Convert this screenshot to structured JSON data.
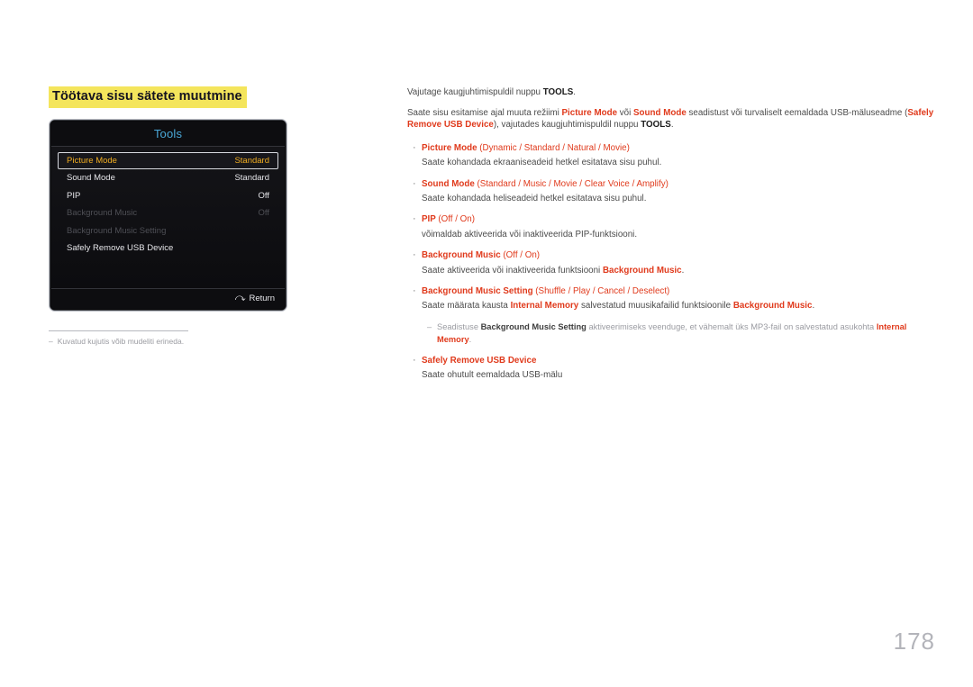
{
  "page": {
    "number": "178",
    "accent_red": "#e03a1c",
    "highlight_yellow": "#f4e55c",
    "osd_selected_orange": "#f0ad22",
    "osd_title_blue": "#4aa8d8"
  },
  "left": {
    "section_title": "Töötava sisu sätete muutmine",
    "osd": {
      "title": "Tools",
      "rows": [
        {
          "label": "Picture Mode",
          "value": "Standard",
          "state": "selected"
        },
        {
          "label": "Sound Mode",
          "value": "Standard",
          "state": "normal"
        },
        {
          "label": "PIP",
          "value": "Off",
          "state": "normal"
        },
        {
          "label": "Background Music",
          "value": "Off",
          "state": "disabled"
        },
        {
          "label": "Background Music Setting",
          "value": "",
          "state": "disabled"
        },
        {
          "label": "Safely Remove USB Device",
          "value": "",
          "state": "normal"
        }
      ],
      "footer": {
        "return_label": "Return",
        "return_icon": "return-arrow-icon"
      }
    },
    "note": {
      "dash": "–",
      "text": "Kuvatud kujutis võib mudeliti erineda."
    }
  },
  "right": {
    "paragraph1": {
      "before": "Vajutage kaugjuhtimispuldil nuppu ",
      "bold": "TOOLS",
      "after": "."
    },
    "paragraph2": {
      "seg1": "Saate sisu esitamise ajal muuta režiimi ",
      "red1": "Picture Mode",
      "seg2": " või ",
      "red2": "Sound Mode",
      "seg3": " seadistust või turvaliselt eemaldada USB-mäluseadme (",
      "red3": "Safely Remove USB Device",
      "seg4": "), vajutades kaugjuhtimispuldil nuppu ",
      "bold1": "TOOLS",
      "seg5": "."
    },
    "bullet_marker": "·",
    "bullets": [
      {
        "name": "Picture Mode",
        "options": "(Dynamic / Standard / Natural / Movie)",
        "desc": "Saate kohandada ekraaniseadeid hetkel esitatava sisu puhul."
      },
      {
        "name": "Sound Mode",
        "options": "(Standard / Music / Movie / Clear Voice / Amplify)",
        "desc": "Saate kohandada heliseadeid hetkel esitatava sisu puhul."
      },
      {
        "name": "PIP",
        "options": "(Off / On)",
        "desc": "võimaldab aktiveerida või inaktiveerida PIP-funktsiooni."
      },
      {
        "name": "Background Music",
        "options": "(Off / On)",
        "desc_pre": "Saate aktiveerida või inaktiveerida funktsiooni ",
        "desc_red": "Background Music",
        "desc_post": "."
      },
      {
        "name": "Background Music Setting",
        "options": "(Shuffle / Play / Cancel / Deselect)",
        "desc_pre": "Saate määrata kausta ",
        "desc_red1": "Internal Memory",
        "desc_mid": " salvestatud muusikafailid funktsioonile ",
        "desc_red2": "Background Music",
        "desc_post": "."
      },
      {
        "name": "Safely Remove USB Device",
        "options": "",
        "desc": "Saate ohutult eemaldada USB-mälu"
      }
    ],
    "subnote": {
      "dash": "–",
      "seg1": "Seadistuse ",
      "dark1": "Background Music Setting",
      "seg2": " aktiveerimiseks veenduge, et vähemalt üks MP3-fail on salvestatud asukohta ",
      "red1": "Internal Memory",
      "seg3": "."
    }
  }
}
